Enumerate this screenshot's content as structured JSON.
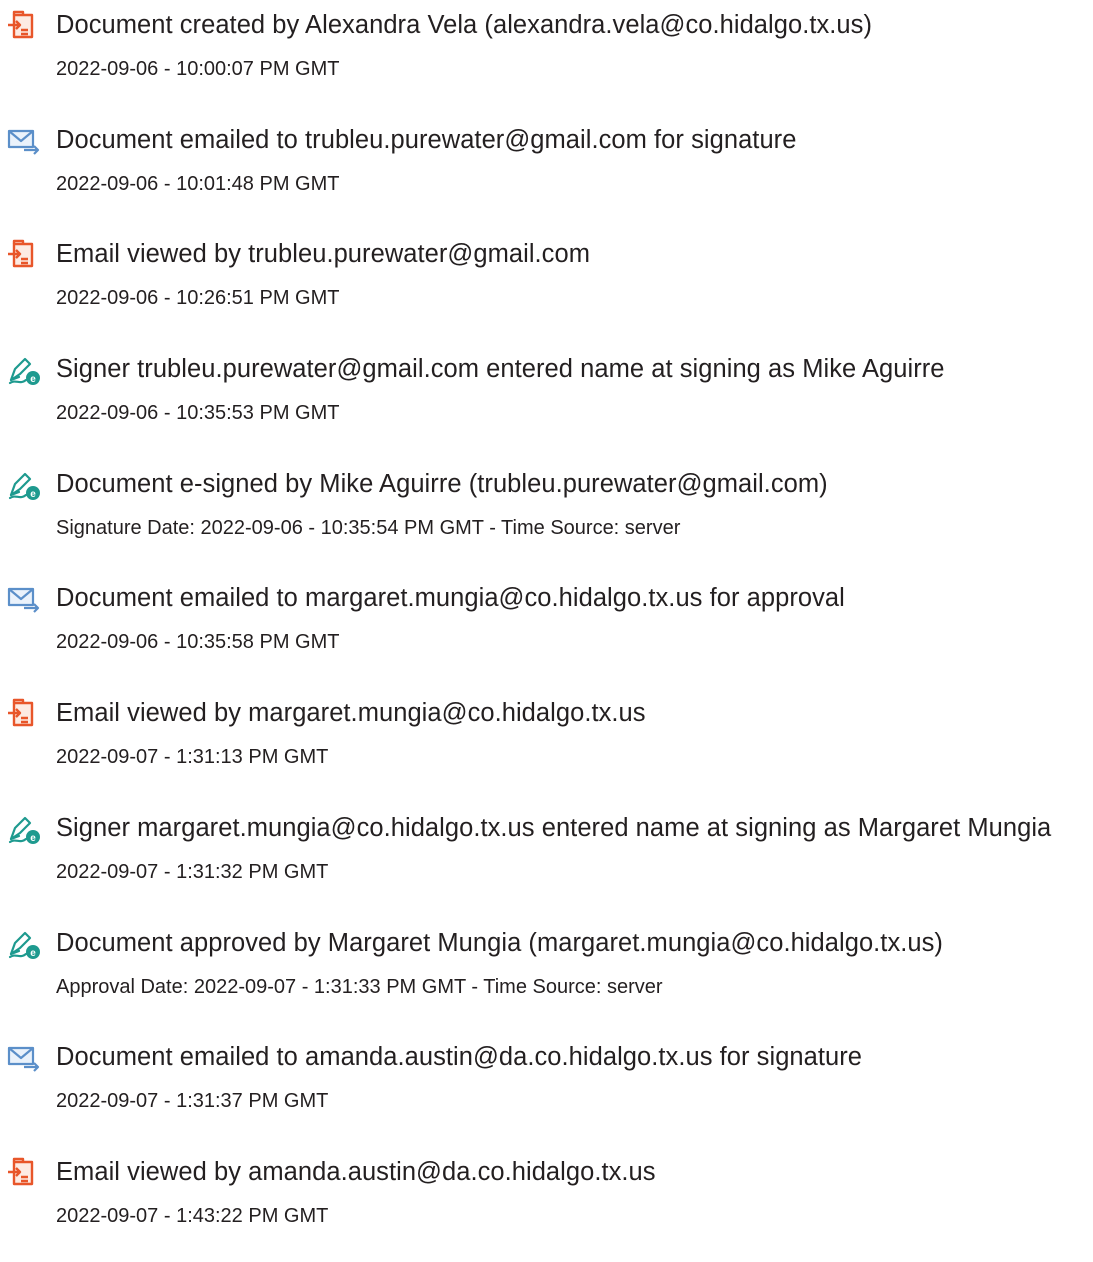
{
  "colors": {
    "text": "#231f20",
    "doc_icon": "#e8562a",
    "mail_icon": "#5b8fc9",
    "sign_icon": "#1e9a8f"
  },
  "events": [
    {
      "icon": "document-icon",
      "title": "Document created by Alexandra Vela (alexandra.vela@co.hidalgo.tx.us)",
      "meta": "2022-09-06 - 10:00:07 PM GMT"
    },
    {
      "icon": "email-sent-icon",
      "title": "Document emailed to trubleu.purewater@gmail.com for signature",
      "meta": "2022-09-06 - 10:01:48 PM GMT"
    },
    {
      "icon": "document-icon",
      "title": "Email viewed by trubleu.purewater@gmail.com",
      "meta": "2022-09-06 - 10:26:51 PM GMT"
    },
    {
      "icon": "e-sign-icon",
      "title": "Signer trubleu.purewater@gmail.com entered name at signing as Mike Aguirre",
      "meta": "2022-09-06 - 10:35:53 PM GMT"
    },
    {
      "icon": "e-sign-icon",
      "title": "Document e-signed by Mike Aguirre (trubleu.purewater@gmail.com)",
      "meta": "Signature Date: 2022-09-06 - 10:35:54 PM GMT - Time Source: server"
    },
    {
      "icon": "email-sent-icon",
      "title": "Document emailed to margaret.mungia@co.hidalgo.tx.us for approval",
      "meta": "2022-09-06 - 10:35:58 PM GMT"
    },
    {
      "icon": "document-icon",
      "title": "Email viewed by margaret.mungia@co.hidalgo.tx.us",
      "meta": "2022-09-07 - 1:31:13 PM GMT"
    },
    {
      "icon": "e-sign-icon",
      "title": "Signer margaret.mungia@co.hidalgo.tx.us entered name at signing as Margaret Mungia",
      "meta": "2022-09-07 - 1:31:32 PM GMT"
    },
    {
      "icon": "e-sign-icon",
      "title": "Document approved by Margaret Mungia (margaret.mungia@co.hidalgo.tx.us)",
      "meta": "Approval Date: 2022-09-07 - 1:31:33 PM GMT - Time Source: server"
    },
    {
      "icon": "email-sent-icon",
      "title": "Document emailed to amanda.austin@da.co.hidalgo.tx.us for signature",
      "meta": "2022-09-07 - 1:31:37 PM GMT"
    },
    {
      "icon": "document-icon",
      "title": "Email viewed by amanda.austin@da.co.hidalgo.tx.us",
      "meta": "2022-09-07 - 1:43:22 PM GMT"
    }
  ]
}
